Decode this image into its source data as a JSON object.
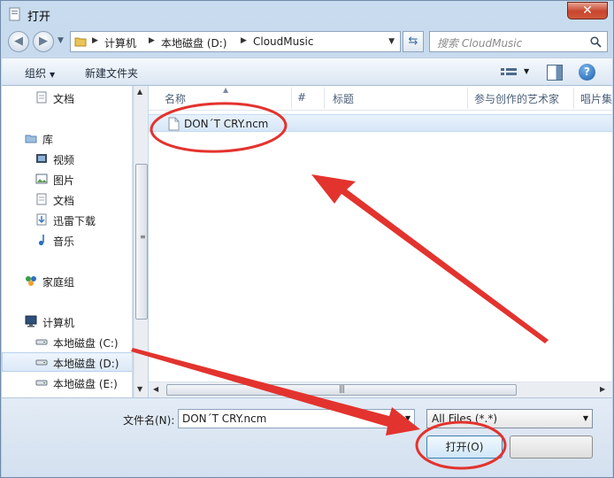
{
  "window": {
    "title": "打开",
    "close_label": "✕"
  },
  "address": {
    "crumbs": [
      "计算机",
      "本地磁盘 (D:)",
      "CloudMusic"
    ]
  },
  "search": {
    "placeholder": "搜索 CloudMusic"
  },
  "toolbar": {
    "organize_label": "组织",
    "new_folder_label": "新建文件夹",
    "help_label": "?"
  },
  "sidebar": {
    "items": [
      {
        "label": "文档",
        "icon": "document-icon"
      },
      {
        "label": "库",
        "icon": "library-icon"
      },
      {
        "label": "视频",
        "icon": "video-icon"
      },
      {
        "label": "图片",
        "icon": "picture-icon"
      },
      {
        "label": "文档",
        "icon": "document-icon"
      },
      {
        "label": "迅雷下载",
        "icon": "download-icon"
      },
      {
        "label": "音乐",
        "icon": "music-icon"
      },
      {
        "label": "家庭组",
        "icon": "homegroup-icon"
      },
      {
        "label": "计算机",
        "icon": "computer-icon"
      },
      {
        "label": "本地磁盘 (C:)",
        "icon": "drive-icon"
      },
      {
        "label": "本地磁盘 (D:)",
        "icon": "drive-icon",
        "selected": true
      },
      {
        "label": "本地磁盘 (E:)",
        "icon": "drive-icon"
      }
    ]
  },
  "file_list": {
    "columns": [
      "名称",
      "#",
      "标题",
      "参与创作的艺术家",
      "唱片集"
    ],
    "files": [
      {
        "name": "DON´T CRY.ncm",
        "selected": true
      }
    ]
  },
  "bottom": {
    "filename_label": "文件名(N):",
    "filename_value": "DON´T CRY.ncm",
    "filter_value": "All Files (*.*)",
    "open_label": "打开(O)"
  },
  "colors": {
    "annotation": "#e3332e",
    "selection": "#d6e6f7",
    "accent": "#3c7fb1"
  }
}
